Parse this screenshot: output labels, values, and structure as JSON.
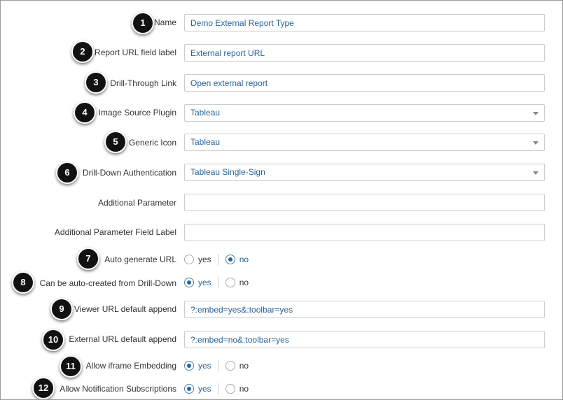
{
  "colors": {
    "accent": "#2a6496",
    "badge": "#111111",
    "border": "#cccccc"
  },
  "fields": [
    {
      "badge": "1",
      "label": "Name",
      "type": "text",
      "value": "Demo External Report Type"
    },
    {
      "badge": "2",
      "label": "Report URL field label",
      "type": "text",
      "value": "External report URL"
    },
    {
      "badge": "3",
      "label": "Drill-Through Link",
      "type": "text",
      "value": "Open external report"
    },
    {
      "badge": "4",
      "label": "Image Source Plugin",
      "type": "select",
      "value": "Tableau",
      "icon": "chevron-down-icon"
    },
    {
      "badge": "5",
      "label": "Generic Icon",
      "type": "select",
      "value": "Tableau",
      "icon": "chevron-down-icon"
    },
    {
      "badge": "6",
      "label": "Drill-Down Authentication",
      "type": "select",
      "value": "Tableau Single-Sign",
      "icon": "chevron-down-icon"
    },
    {
      "label": "Additional Parameter",
      "type": "text",
      "value": ""
    },
    {
      "label": "Additional Parameter Field Label",
      "type": "text",
      "value": ""
    },
    {
      "badge": "7",
      "label": "Auto generate URL",
      "type": "radio",
      "options": [
        "yes",
        "no"
      ],
      "selected": "no"
    },
    {
      "badge": "8",
      "label": "Can be auto-created from Drill-Down",
      "type": "radio",
      "options": [
        "yes",
        "no"
      ],
      "selected": "yes"
    },
    {
      "badge": "9",
      "label": "Viewer URL default append",
      "type": "text",
      "value": "?:embed=yes&:toolbar=yes"
    },
    {
      "badge": "10",
      "label": "External URL default append",
      "type": "text",
      "value": "?:embed=no&:toolbar=yes"
    },
    {
      "badge": "11",
      "label": "Allow iframe Embedding",
      "type": "radio",
      "options": [
        "yes",
        "no"
      ],
      "selected": "yes"
    },
    {
      "badge": "12",
      "label": "Allow Notification Subscriptions",
      "type": "radio",
      "options": [
        "yes",
        "no"
      ],
      "selected": "yes"
    }
  ]
}
